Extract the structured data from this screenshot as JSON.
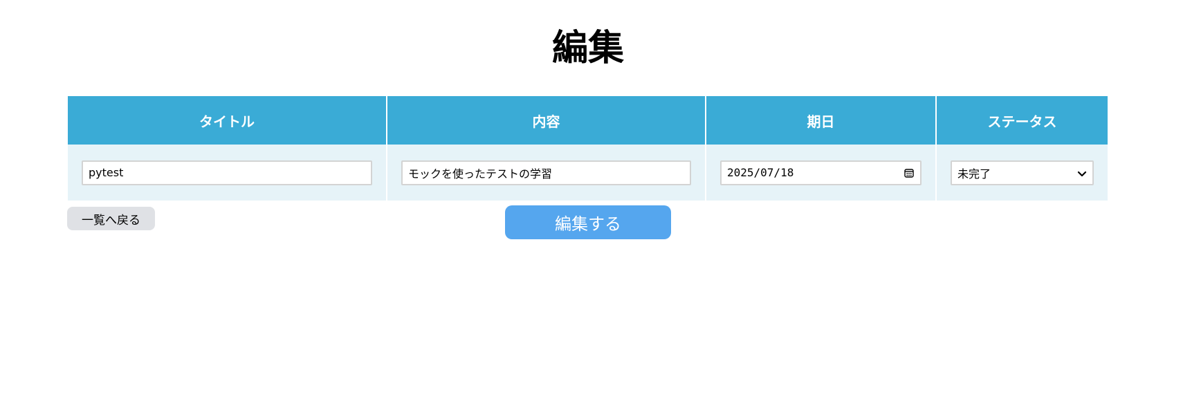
{
  "page": {
    "title": "編集"
  },
  "table": {
    "headers": {
      "title": "タイトル",
      "content": "内容",
      "due_date": "期日",
      "status": "ステータス"
    },
    "row": {
      "title_value": "pytest",
      "content_value": "モックを使ったテストの学習",
      "due_date_value": "2025/07/18",
      "status_selected": "未完了"
    }
  },
  "actions": {
    "back_label": "一覧へ戻る",
    "submit_label": "編集する"
  },
  "colors": {
    "header_bg": "#3aabd6",
    "row_bg": "#e6f3f8",
    "submit_bg": "#55a6ee",
    "back_bg": "#dfe1e5"
  },
  "icons": {
    "date_picker": "calendar-icon",
    "select_arrow": "chevron-down-icon"
  }
}
